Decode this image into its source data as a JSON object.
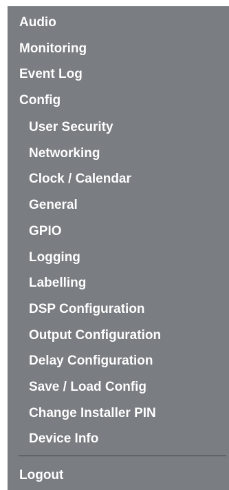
{
  "menu": {
    "top_items": [
      {
        "label": "Audio"
      },
      {
        "label": "Monitoring"
      },
      {
        "label": "Event Log"
      },
      {
        "label": "Config"
      }
    ],
    "config_items": [
      {
        "label": "User Security"
      },
      {
        "label": "Networking"
      },
      {
        "label": "Clock / Calendar"
      },
      {
        "label": "General"
      },
      {
        "label": "GPIO"
      },
      {
        "label": "Logging"
      },
      {
        "label": "Labelling"
      },
      {
        "label": "DSP Configuration"
      },
      {
        "label": "Output Configuration"
      },
      {
        "label": "Delay Configuration"
      },
      {
        "label": "Save / Load Config"
      },
      {
        "label": "Change Installer PIN"
      },
      {
        "label": "Device Info"
      }
    ],
    "logout": {
      "label": "Logout"
    }
  },
  "colors": {
    "panel_background": "#7a7e83",
    "text": "#ffffff",
    "divider": "#3e4145"
  }
}
